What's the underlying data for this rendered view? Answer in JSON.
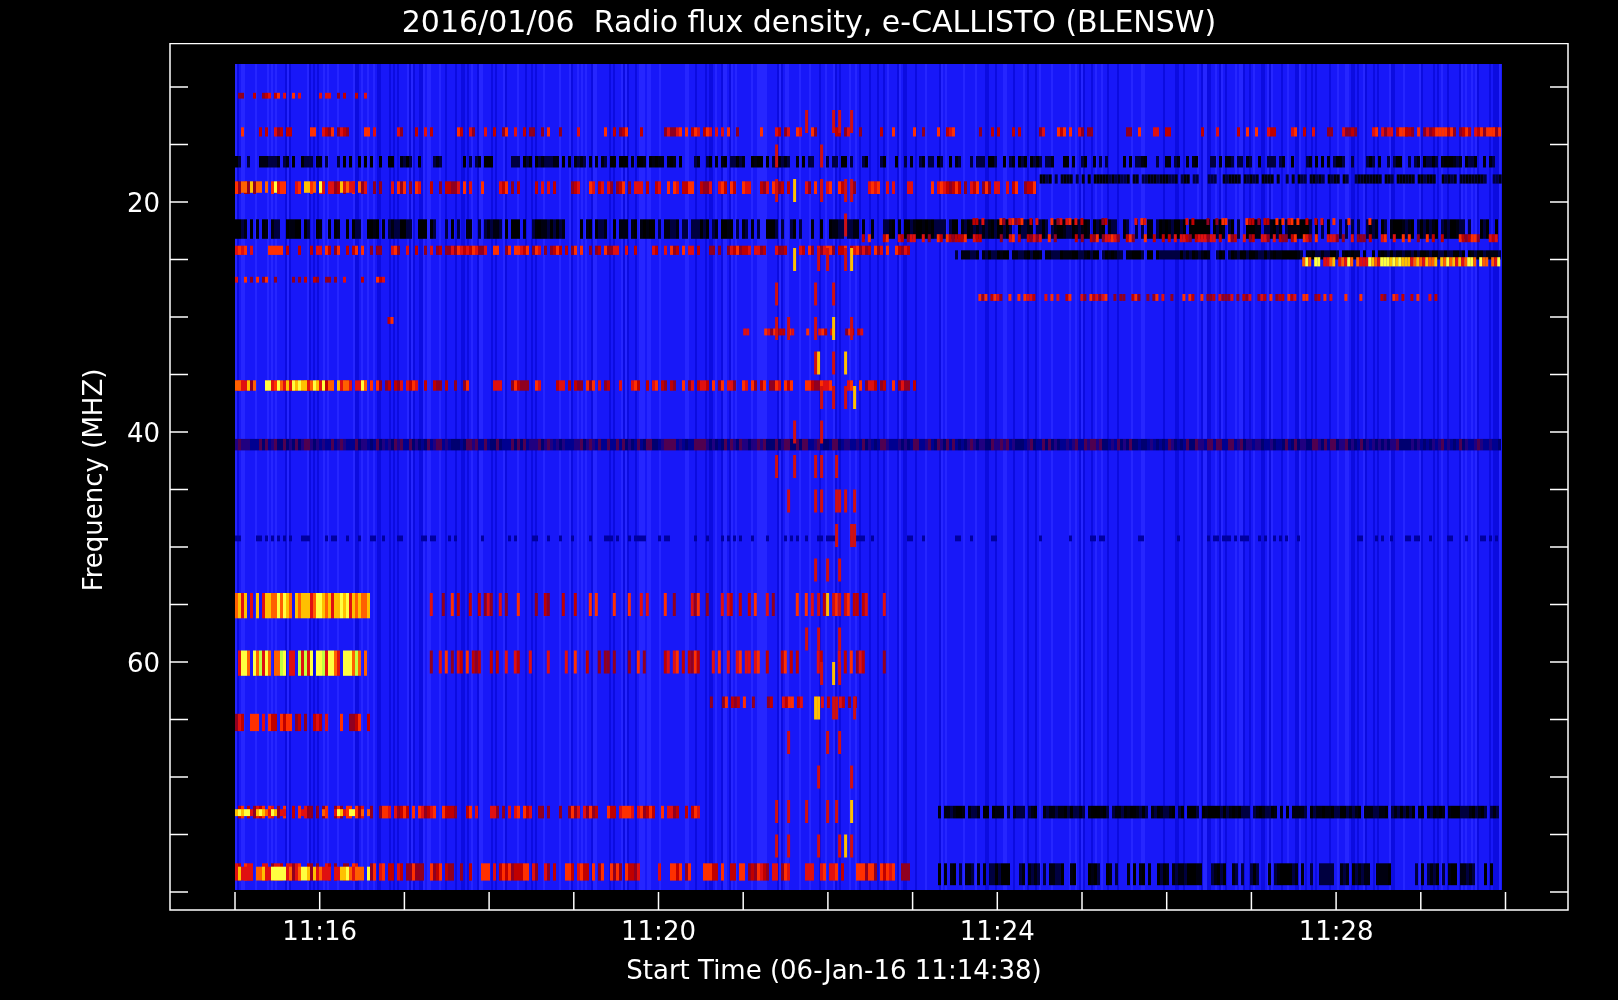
{
  "title": "2016/01/06  Radio flux density, e-CALLISTO (BLENSW)",
  "plot": {
    "ylabel": "Frequency (MHZ)",
    "xlabel": "Start Time (06-Jan-16 11:14:38)",
    "yticks": [
      "20",
      "40",
      "60"
    ],
    "xticks": [
      "11:16",
      "11:20",
      "11:24",
      "11:28"
    ]
  }
}
